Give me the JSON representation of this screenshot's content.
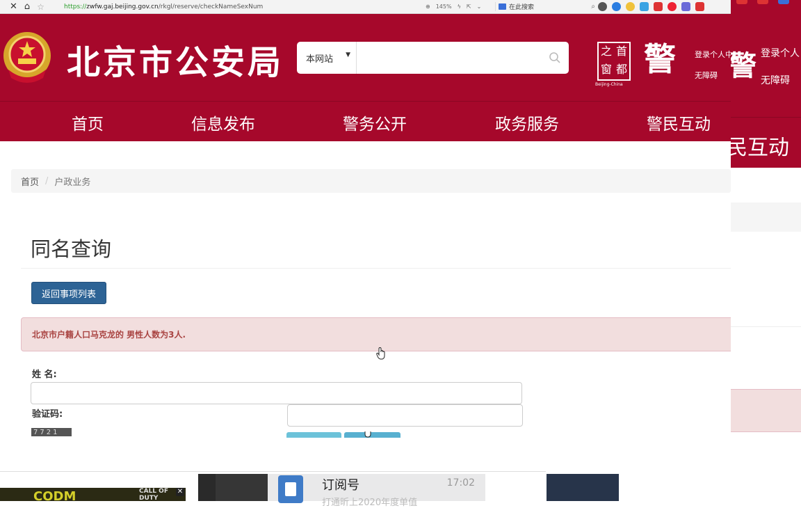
{
  "browser": {
    "url_proto": "https://",
    "url_domain": "zwfw.gaj.beijing.gov.cn",
    "url_path": "/rkgl/reserve/checkNameSexNum",
    "zoom": "145%",
    "search_placeholder": "在此搜索"
  },
  "header": {
    "site_title": "北京市公安局",
    "search_scope": "本网站",
    "search_value": "",
    "seal_chars": [
      "之",
      "首",
      "窗",
      "都"
    ],
    "seal_caption": "Beijing-China",
    "jing_char": "警",
    "login_label": "登录个人中心",
    "accessibility_label": "无障碍"
  },
  "nav": {
    "items": [
      {
        "label": "首页"
      },
      {
        "label": "信息发布"
      },
      {
        "label": "警务公开"
      },
      {
        "label": "政务服务"
      },
      {
        "label": "警民互动"
      }
    ]
  },
  "breadcrumb": {
    "home": "首页",
    "separator": "/",
    "current": "户政业务"
  },
  "main": {
    "page_title": "同名查询",
    "back_button": "返回事项列表",
    "alert_message": "北京市户籍人口马克龙的 男性人数为3人.",
    "name_label": "姓    名:",
    "name_value": "",
    "captcha_label": "验证码:",
    "captcha_value": "",
    "captcha_image_text": "7721"
  },
  "right_window": {
    "login_label": "登录个人",
    "accessibility_label": "无障碍",
    "nav_fragment": "民互动"
  },
  "taskbar": {
    "game_text": "CODM",
    "game_badge": "CALL OF DUTY",
    "notification_title": "订阅号",
    "notification_time": "17:02",
    "notification_sub": "打通昕上2020年度单值"
  },
  "colors": {
    "brand": "#a6082b",
    "button": "#2d6395",
    "alert_bg": "#f2dede",
    "alert_text": "#a94442"
  }
}
